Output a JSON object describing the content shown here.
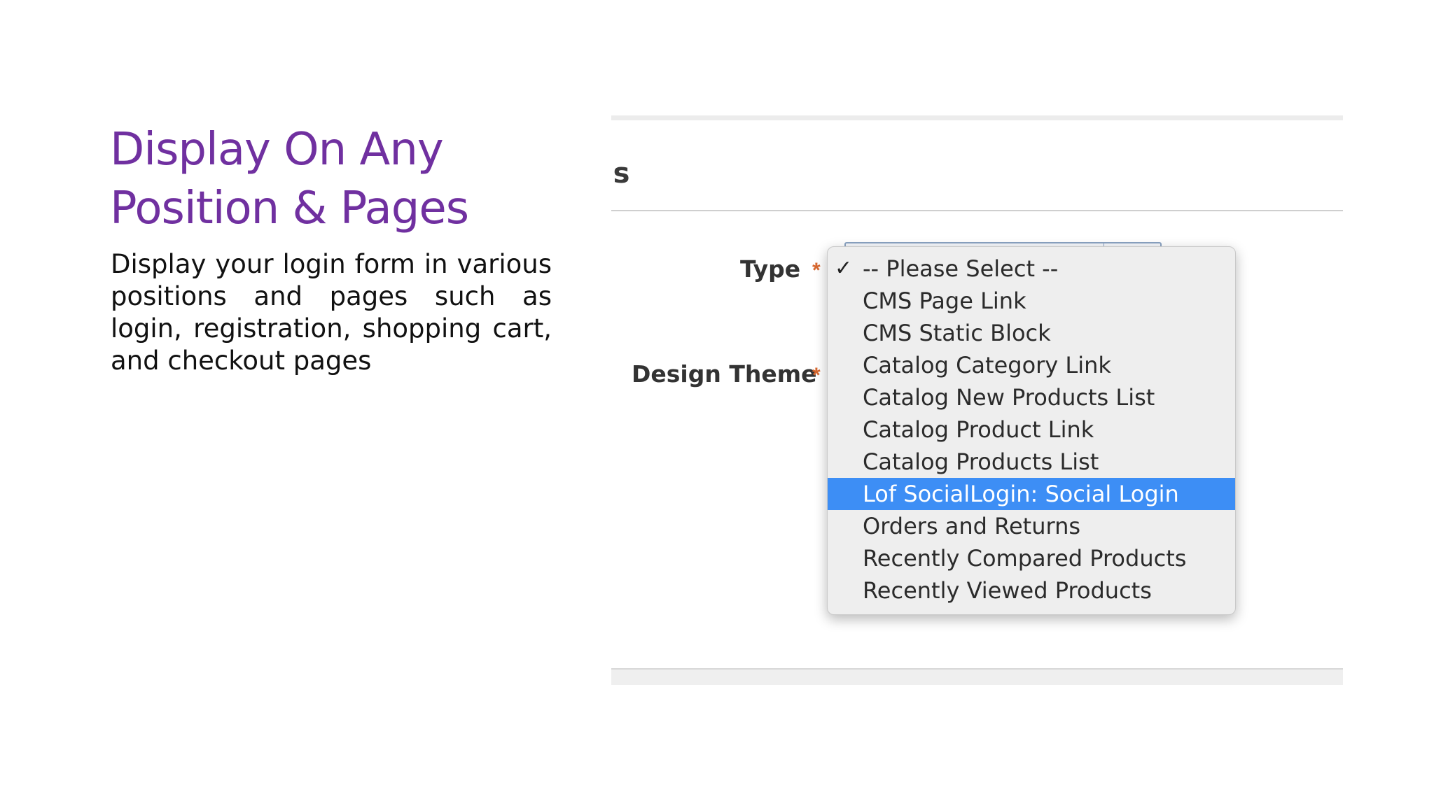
{
  "slide": {
    "title_line1": "Display On Any",
    "title_line2": "Position & Pages",
    "body": "Display your login form in various positions and pages such as login, registration, shopping cart, and checkout pages"
  },
  "screenshot": {
    "section_heading_partial": "gs",
    "fields": {
      "type_label": "Type",
      "design_theme_label": "Design Theme",
      "required_marker": "*"
    },
    "dropdown": {
      "check_glyph": "✓",
      "options": [
        "-- Please Select --",
        "CMS Page Link",
        "CMS Static Block",
        "Catalog Category Link",
        "Catalog New Products List",
        "Catalog Product Link",
        "Catalog Products List",
        "Lof SocialLogin: Social Login",
        "Orders and Returns",
        "Recently Compared Products",
        "Recently Viewed Products"
      ],
      "checked_index": 0,
      "highlighted_index": 7
    }
  },
  "colors": {
    "title": "#7030a0",
    "highlight": "#3d8ef5",
    "required": "#d8682f"
  }
}
